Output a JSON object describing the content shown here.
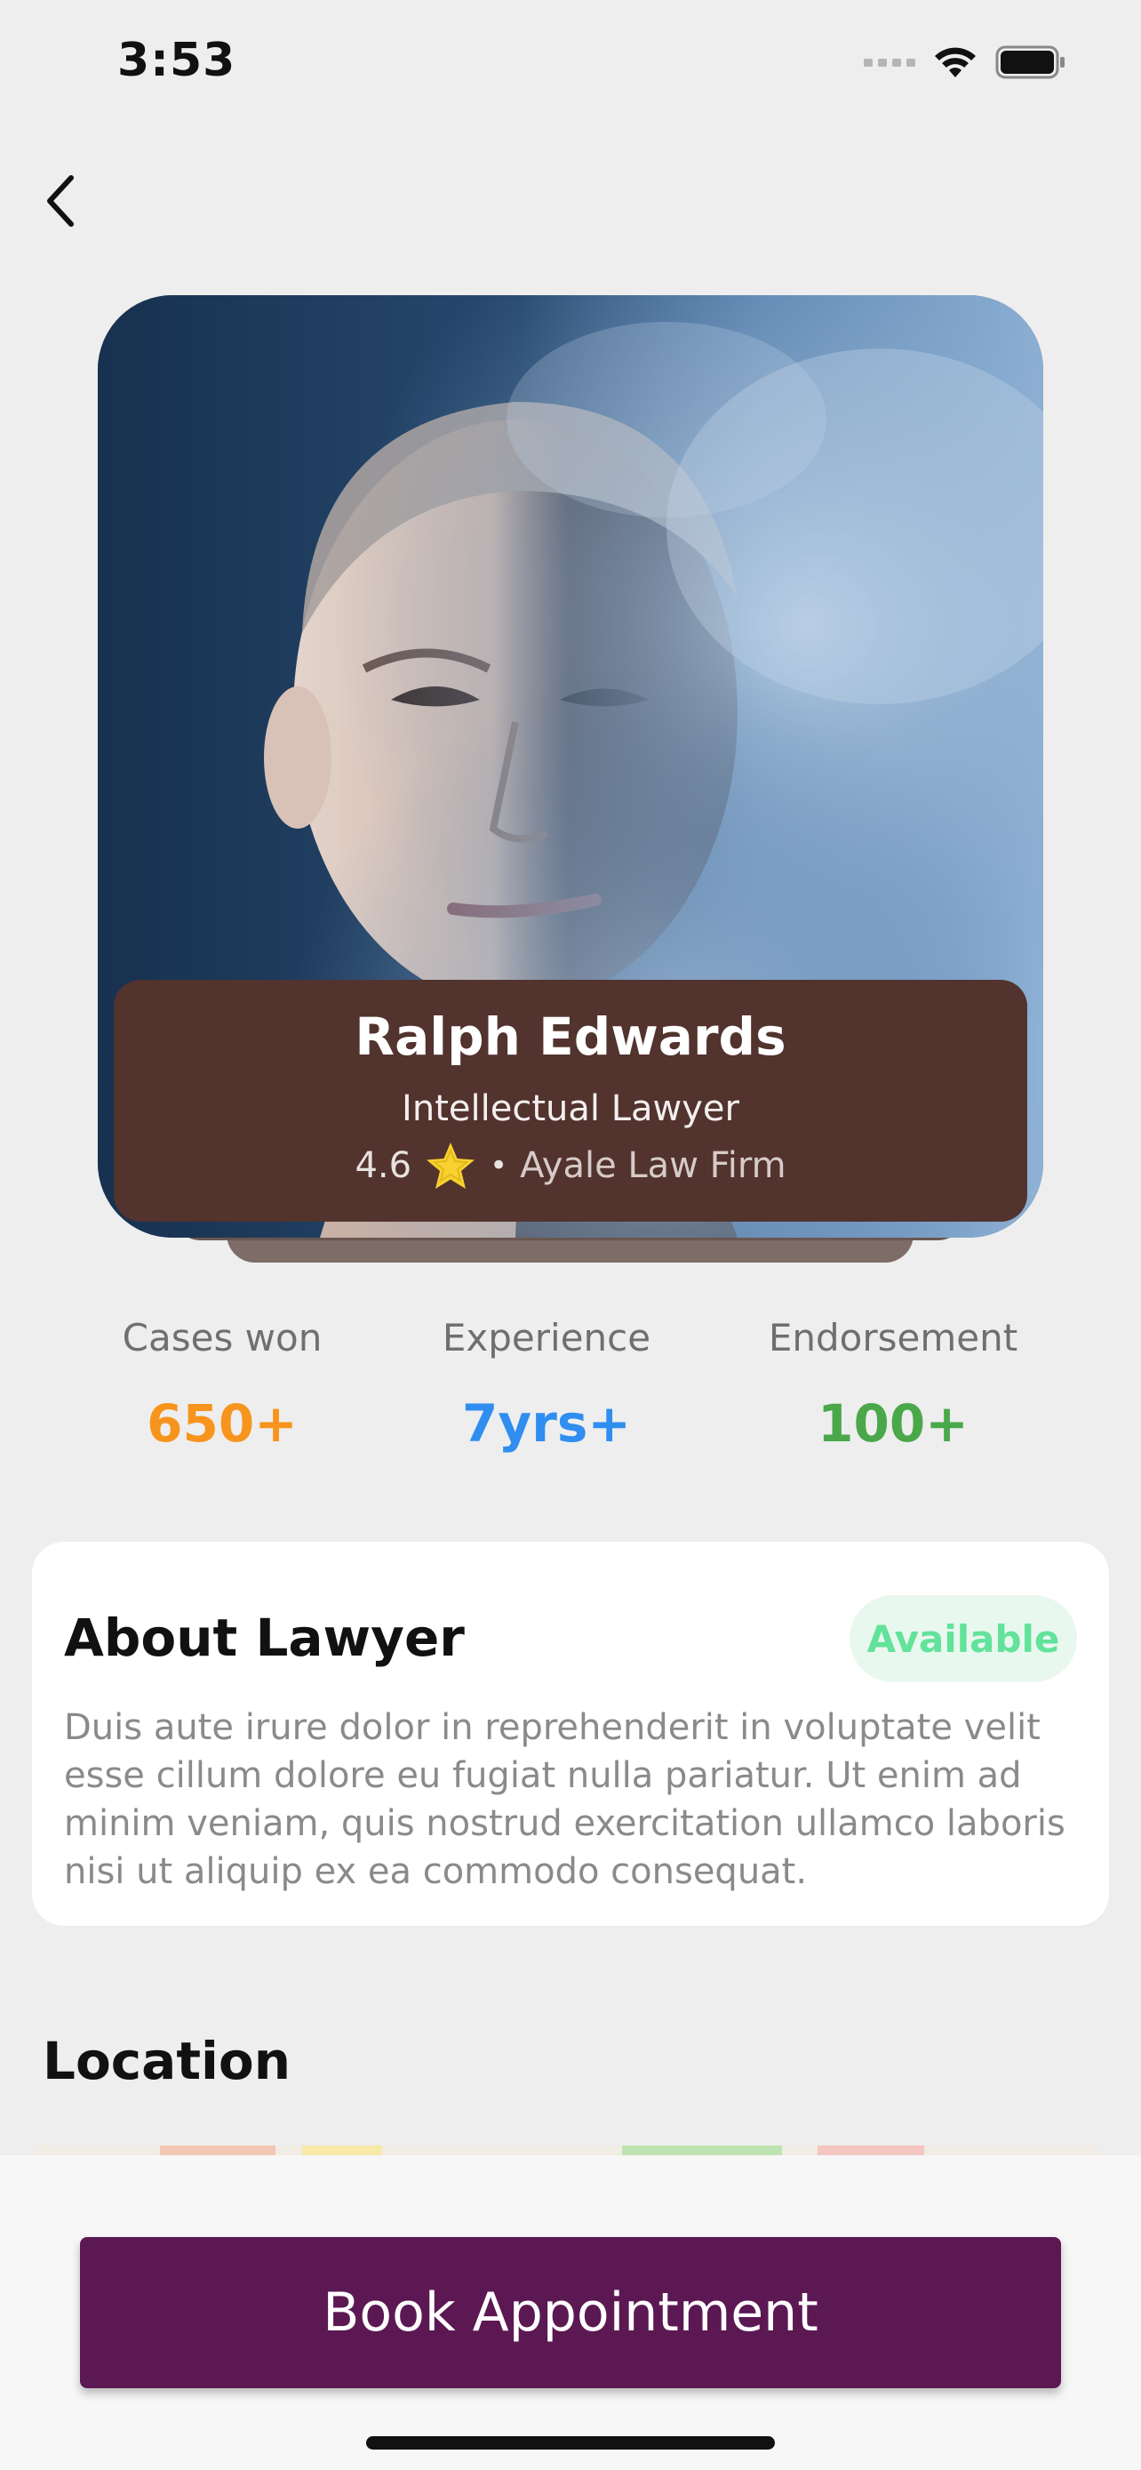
{
  "status_bar": {
    "time": "3:53"
  },
  "profile": {
    "name": "Ralph Edwards",
    "title": "Intellectual Lawyer",
    "rating": "4.6",
    "firm": "Ayale Law Firm"
  },
  "stats": [
    {
      "label": "Cases won",
      "value": "650+",
      "color": "#f7941d"
    },
    {
      "label": "Experience",
      "value": "7yrs+",
      "color": "#2f8ef0"
    },
    {
      "label": "Endorsement",
      "value": "100+",
      "color": "#4aa84a"
    }
  ],
  "about": {
    "title": "About Lawyer",
    "badge": "Available",
    "text": "Duis aute irure dolor in reprehenderit in voluptate velit esse cillum dolore eu fugiat nulla pariatur. Ut enim ad minim veniam, quis nostrud exercitation ullamco laboris nisi ut aliquip ex ea commodo consequat."
  },
  "location": {
    "title": "Location"
  },
  "cta": {
    "label": "Book Appointment"
  },
  "colors": {
    "info_card_bg": "#52332e",
    "cta_bg": "#5b1853",
    "badge_text": "#62e29a",
    "badge_bg": "#e9f8ef",
    "star": "#f9d12e"
  },
  "icons": {
    "back": "chevron-left-icon",
    "star": "star-icon",
    "wifi": "wifi-icon",
    "battery": "battery-icon"
  }
}
